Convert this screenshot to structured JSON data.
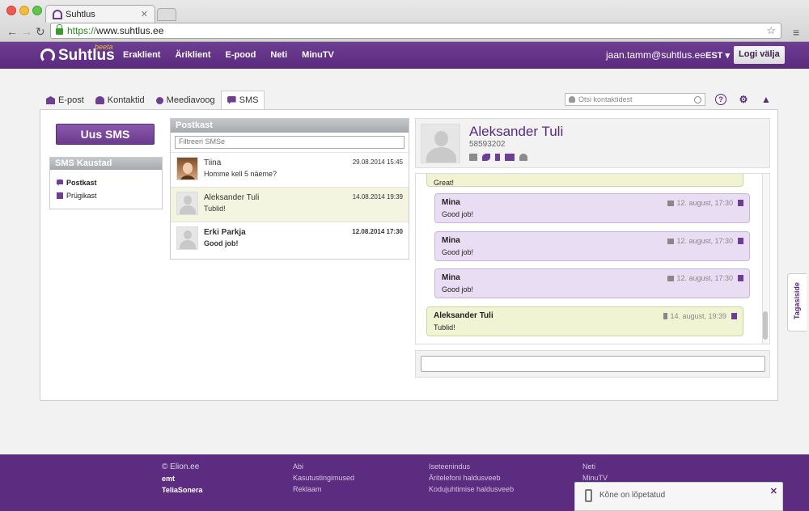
{
  "browser": {
    "tab_title": "Suhtlus",
    "url_scheme": "https://",
    "url_rest": "www.suhtlus.ee"
  },
  "topbar": {
    "logo_text": "Suhtlus",
    "logo_badge": "beeta",
    "nav": [
      "Eraklient",
      "Äriklient",
      "E-pood",
      "Neti",
      "MinuTV"
    ],
    "user_email": "jaan.tamm@suhtlus.ee",
    "language": "EST",
    "logout": "Logi välja"
  },
  "tabs": [
    {
      "label": "E-post",
      "icon": "envelope-icon"
    },
    {
      "label": "Kontaktid",
      "icon": "person-icon"
    },
    {
      "label": "Meediavoog",
      "icon": "share-icon"
    },
    {
      "label": "SMS",
      "icon": "chat-icon",
      "active": true
    }
  ],
  "search": {
    "placeholder": "Otsi kontaktidest"
  },
  "sidebar": {
    "new_sms": "Uus SMS",
    "folders_title": "SMS Kaustad",
    "folders": [
      {
        "label": "Postkast",
        "icon": "inbox-icon"
      },
      {
        "label": "Prügikast",
        "icon": "trash-icon"
      }
    ]
  },
  "inbox": {
    "title": "Postkast",
    "filter_placeholder": "Filtreeri SMSe",
    "messages": [
      {
        "name": "Tiina",
        "preview": "Homme kell 5 näeme?",
        "date": "29.08.2014 15:45"
      },
      {
        "name": "Aleksander Tuli",
        "preview": "Tublid!",
        "date": "14.08.2014 19:39"
      },
      {
        "name": "Erki Parkja",
        "preview": "Good job!",
        "date": "12.08.2014 17:30"
      }
    ]
  },
  "conversation": {
    "contact_name": "Aleksander Tuli",
    "contact_phone": "58593202",
    "messages": [
      {
        "sender": "",
        "text": "Great!",
        "time": "",
        "mine": false
      },
      {
        "sender": "Mina",
        "text": "Good job!",
        "time": "12. august, 17:30",
        "mine": true
      },
      {
        "sender": "Mina",
        "text": "Good job!",
        "time": "12. august, 17:30",
        "mine": true
      },
      {
        "sender": "Mina",
        "text": "Good job!",
        "time": "12. august, 17:30",
        "mine": true
      },
      {
        "sender": "Aleksander Tuli",
        "text": "Tublid!",
        "time": "14. august, 19:39",
        "mine": false
      }
    ]
  },
  "feedback": "Tagasiside",
  "footer": {
    "brand": "© Elion.ee",
    "partners": [
      "emt",
      "TeliaSonera"
    ],
    "col1": [
      "Abi",
      "Kasutustingimused",
      "Reklaam"
    ],
    "col2": [
      "Iseteenindus",
      "Äritelefoni haldusveeb",
      "Kodujuhtimise haldusveeb"
    ],
    "col3": [
      "Neti",
      "MinuTV"
    ]
  },
  "toast": {
    "text": "Kõne on lõpetatud"
  }
}
